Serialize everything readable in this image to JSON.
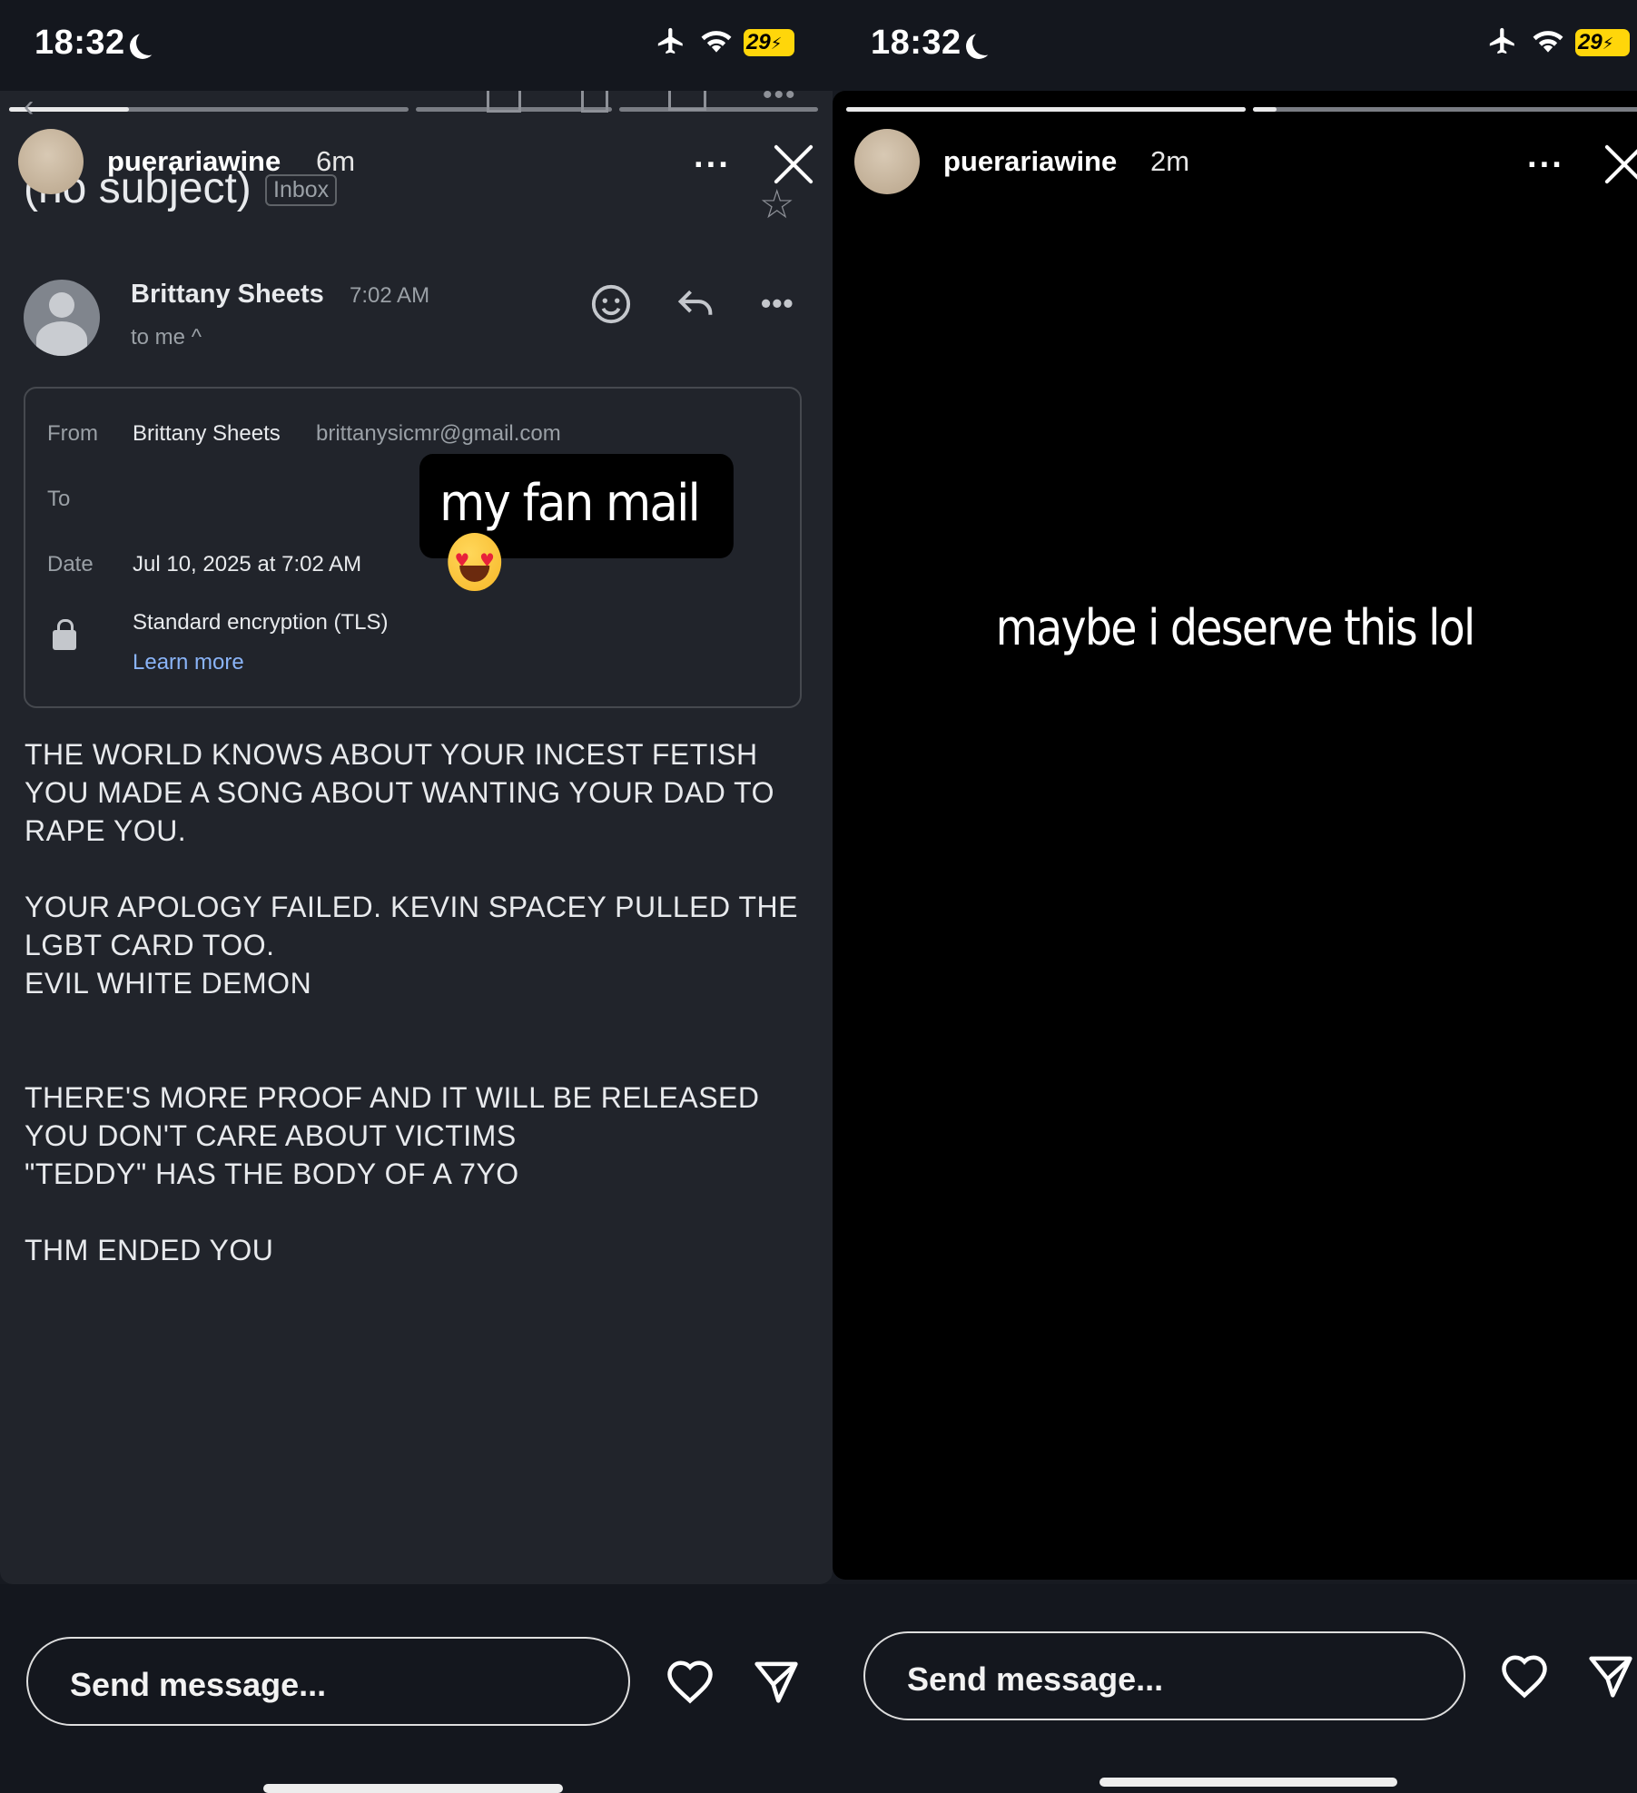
{
  "left": {
    "status": {
      "time": "18:32",
      "battery": "29"
    },
    "story": {
      "username": "puerariawine",
      "time": "6m"
    },
    "email": {
      "subject": "(no subject)",
      "folder": "Inbox",
      "sender": "Brittany Sheets",
      "time": "7:02 AM",
      "to_line": "to me ^",
      "details": {
        "from_label": "From",
        "from_name": "Brittany Sheets",
        "from_email": "brittanysicmr@gmail.com",
        "to_label": "To",
        "date_label": "Date",
        "date_value": "Jul 10, 2025 at 7:02 AM",
        "encryption": "Standard encryption (TLS)",
        "learn_more": "Learn more"
      },
      "body": "THE WORLD KNOWS ABOUT YOUR INCEST FETISH\nYOU MADE A SONG ABOUT WANTING YOUR DAD TO\nRAPE YOU.\n\nYOUR APOLOGY FAILED. KEVIN SPACEY PULLED THE\nLGBT CARD TOO.\nEVIL WHITE DEMON\n\n\nTHERE'S MORE PROOF AND IT WILL BE RELEASED\nYOU DON'T CARE ABOUT VICTIMS\n\"TEDDY\" HAS THE BODY OF A 7YO\n\nTHM ENDED YOU"
    },
    "sticker": "my fan mail",
    "footer": {
      "placeholder": "Send message..."
    }
  },
  "right": {
    "status": {
      "time": "18:32",
      "battery": "29"
    },
    "story": {
      "username": "puerariawine",
      "time": "2m"
    },
    "caption": "maybe i deserve this lol",
    "footer": {
      "placeholder": "Send message..."
    }
  },
  "icons": {
    "status": [
      "moon-icon",
      "airplane-icon",
      "wifi-icon",
      "battery-icon"
    ],
    "story": [
      "more-icon",
      "close-icon",
      "heart-icon",
      "send-icon"
    ],
    "email": [
      "back-icon",
      "archive-icon",
      "trash-icon",
      "mail-icon",
      "star-icon",
      "emoji-icon",
      "reply-icon",
      "lock-icon"
    ]
  },
  "colors": {
    "link": "#8ab4f8",
    "battery": "#ffd60a",
    "email_bg": "#21242b"
  },
  "progress": {
    "left_segments": [
      0.3,
      0,
      0
    ],
    "right_segments": [
      1,
      0.03
    ]
  }
}
